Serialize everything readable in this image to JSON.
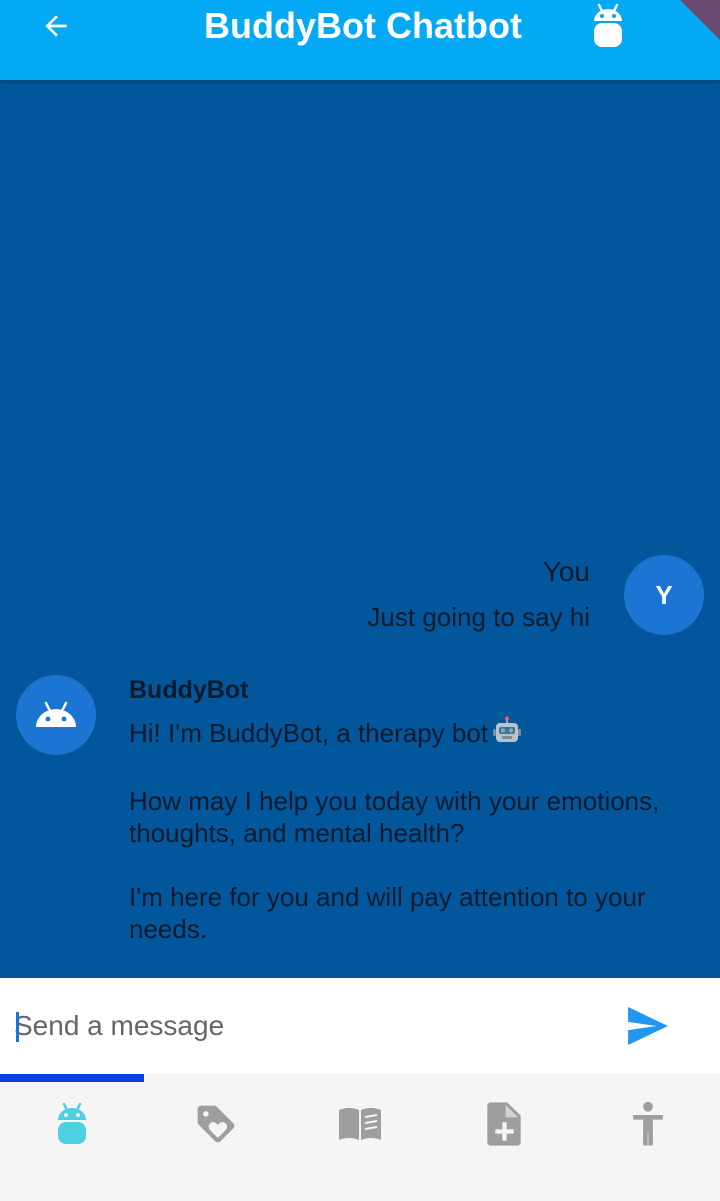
{
  "app_bar": {
    "title": "BuddyBot Chatbot",
    "back_icon": "arrow-back-icon",
    "bot_icon": "android-icon"
  },
  "messages": [
    {
      "sender": "You",
      "avatar_letter": "Y",
      "text": "Just going to say hi"
    },
    {
      "sender": "BuddyBot",
      "avatar_icon": "android-icon",
      "paragraphs": [
        "Hi! I'm BuddyBot, a therapy bot",
        "How may I help you today with your emotions, thoughts, and mental health?",
        "I'm here for you and will pay attention to your needs."
      ],
      "emoji_icon": "robot-face-icon"
    }
  ],
  "composer": {
    "placeholder": "Send a message",
    "send_icon": "send-icon"
  },
  "progress": {
    "fraction": 0.2
  },
  "bottom_nav": {
    "items": [
      {
        "icon": "android-icon",
        "selected": true
      },
      {
        "icon": "tag-heart-icon",
        "selected": false
      },
      {
        "icon": "book-icon",
        "selected": false
      },
      {
        "icon": "note-add-icon",
        "selected": false
      },
      {
        "icon": "accessibility-icon",
        "selected": false
      }
    ]
  },
  "colors": {
    "app_bar": "#03a9f4",
    "chat_background": "#02579c",
    "avatar": "#1c75d2",
    "nav_selected": "#4dd0e1",
    "nav_unselected": "#9e9e9e",
    "progress": "#0b3ee4"
  }
}
